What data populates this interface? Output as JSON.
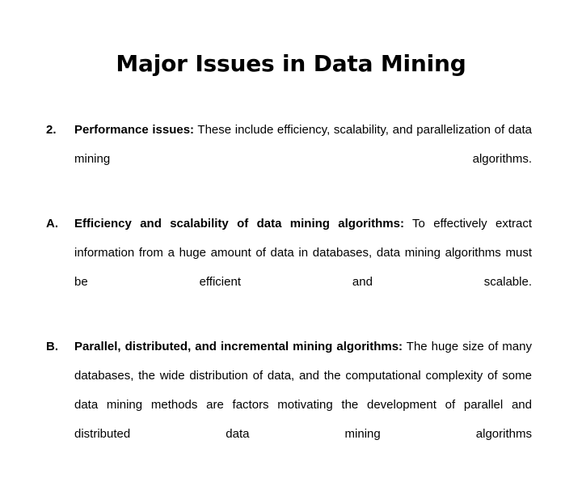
{
  "slide": {
    "title": "Major Issues in Data Mining",
    "background_color": "#ffffff",
    "text_color": "#000000",
    "bullets": [
      {
        "marker": "2.",
        "lead": "Performance issues:",
        "rest": " These include efficiency, scalability, and parallelization of data mining algorithms."
      },
      {
        "marker": "A.",
        "lead": "Efficiency and scalability of data mining algorithms:",
        "rest": " To effectively extract information from a huge amount of data in databases, data mining algorithms must be efficient and scalable."
      },
      {
        "marker": "B.",
        "lead": "Parallel, distributed, and incremental mining algorithms:",
        "rest": " The huge size of many databases, the wide distribution of data, and the computational complexity of some data mining methods are factors motivating the development of parallel and distributed data mining algorithms"
      }
    ]
  }
}
